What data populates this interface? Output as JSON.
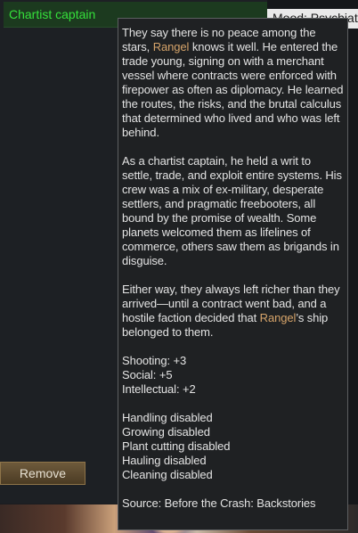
{
  "list": {
    "selected_item": "Chartist captain",
    "remove_label": "Remove"
  },
  "mood_tab": {
    "text": "Mood: Psychiatric"
  },
  "tooltip": {
    "para1": {
      "a": "They say there is no peace among the stars, ",
      "name": "Rangel",
      "b": " knows it well. He entered the trade young, signing on with a merchant vessel where contracts were enforced with firepower as often as diplomacy. He learned the routes, the risks, and the brutal calculus that determined who lived and who was left behind."
    },
    "para2": "As a chartist captain, he held a writ to settle, trade, and exploit entire systems. His crew was a mix of ex-military, desperate settlers, and pragmatic freebooters, all bound by the promise of wealth. Some planets welcomed them as lifelines of commerce, others saw them as brigands in disguise.",
    "para3": {
      "a": "Either way, they always left richer than they arrived—until a contract went bad, and a hostile faction decided that ",
      "name": "Rangel",
      "b": "’s ship belonged to them."
    },
    "stats": [
      "Shooting: +3",
      "Social: +5",
      "Intellectual: +2"
    ],
    "disabled": [
      "Handling disabled",
      "Growing disabled",
      "Plant cutting disabled",
      "Hauling disabled",
      "Cleaning disabled"
    ],
    "source": "Source: Before the Crash: Backstories",
    "highlight_color": "#d6a46a"
  }
}
